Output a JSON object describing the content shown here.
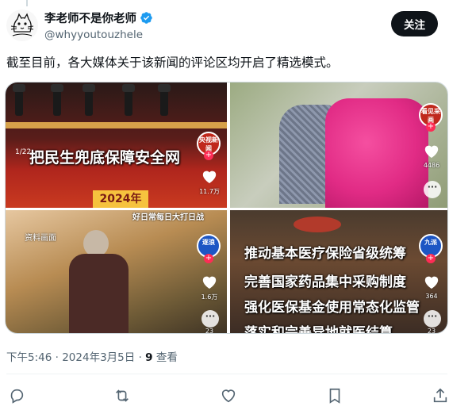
{
  "author": {
    "display_name": "李老师不是你老师",
    "handle": "@whyyoutouzhele",
    "verified": true
  },
  "follow_label": "关注",
  "tweet_text": "截至目前，各大媒体关于该新闻的评论区均开启了精选模式。",
  "media": {
    "tile1": {
      "caption": "把民生兜底保障安全网",
      "counter": "1/22",
      "year": "2024年",
      "badge": "央视新闻",
      "likes": "11.7万",
      "badge_color": "#c0281c"
    },
    "tile2": {
      "badge": "看见采画",
      "likes": "4486",
      "badge_color": "#c0281c"
    },
    "tile3": {
      "tag": "资料画面",
      "top_strip": "好日常每日大打日战",
      "badge": "逐浪",
      "likes": "1.6万",
      "comments": "23",
      "badge_color": "#1d56c4"
    },
    "tile4": {
      "lines": [
        "推动基本医疗保险省级统筹",
        "完善国家药品集中采购制度",
        "强化医保基金使用常态化监管",
        "落实和完善异地就医结算"
      ],
      "badge": "九派",
      "likes": "364",
      "comments": "23",
      "badge_color": "#1d56c4"
    }
  },
  "meta": {
    "time": "下午5:46",
    "date": "2024年3月5日",
    "views_count": "9",
    "views_label": "查看"
  },
  "icons": {
    "reply": "reply-icon",
    "retweet": "retweet-icon",
    "like": "heart-icon",
    "bookmark": "bookmark-icon",
    "share": "share-icon",
    "more": "more-icon"
  },
  "colors": {
    "text_primary": "#0f1419",
    "text_secondary": "#536471",
    "verified": "#1d9bf0",
    "button_bg": "#0f1419"
  }
}
